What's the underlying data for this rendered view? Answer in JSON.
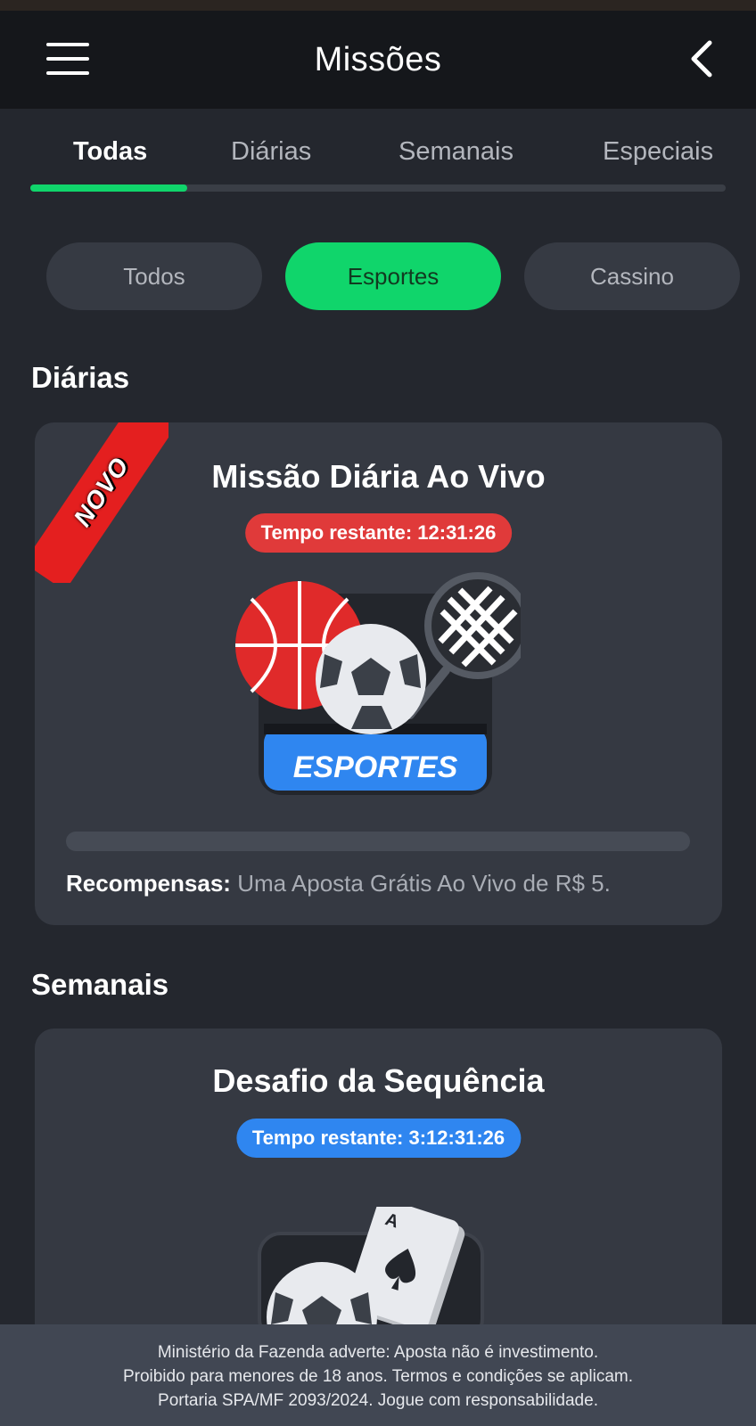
{
  "header": {
    "title": "Missões",
    "menu_icon": "hamburger-menu-icon",
    "back_icon": "chevron-left-icon"
  },
  "tabs": [
    {
      "label": "Todas",
      "active": true
    },
    {
      "label": "Diárias",
      "active": false
    },
    {
      "label": "Semanais",
      "active": false
    },
    {
      "label": "Especiais",
      "active": false
    }
  ],
  "filters": [
    {
      "label": "Todos",
      "active": false
    },
    {
      "label": "Esportes",
      "active": true
    },
    {
      "label": "Cassino",
      "active": false
    }
  ],
  "sections": {
    "daily": {
      "title": "Diárias",
      "card": {
        "badge": "NOVO",
        "title": "Missão Diária Ao Vivo",
        "timer": "Tempo restante: 12:31:26",
        "timer_color": "#e03a3a",
        "image_label": "ESPORTES",
        "progress": 0,
        "reward_label": "Recompensas:",
        "reward_text": "Uma Aposta Grátis Ao Vivo de R$ 5."
      }
    },
    "weekly": {
      "title": "Semanais",
      "card": {
        "title": "Desafio da Sequência",
        "timer": "Tempo restante: 3:12:31:26",
        "timer_color": "#2f86f0",
        "card_letter": "A"
      }
    }
  },
  "footer": {
    "line1": "Ministério da Fazenda adverte: Aposta não é investimento.",
    "line2": "Proibido para menores de 18 anos. Termos e condições se aplicam.",
    "line3": "Portaria SPA/MF 2093/2024. Jogue com responsabilidade."
  },
  "colors": {
    "accent": "#10d56b",
    "background": "#24272e",
    "card": "#353942",
    "header": "#15171b"
  }
}
